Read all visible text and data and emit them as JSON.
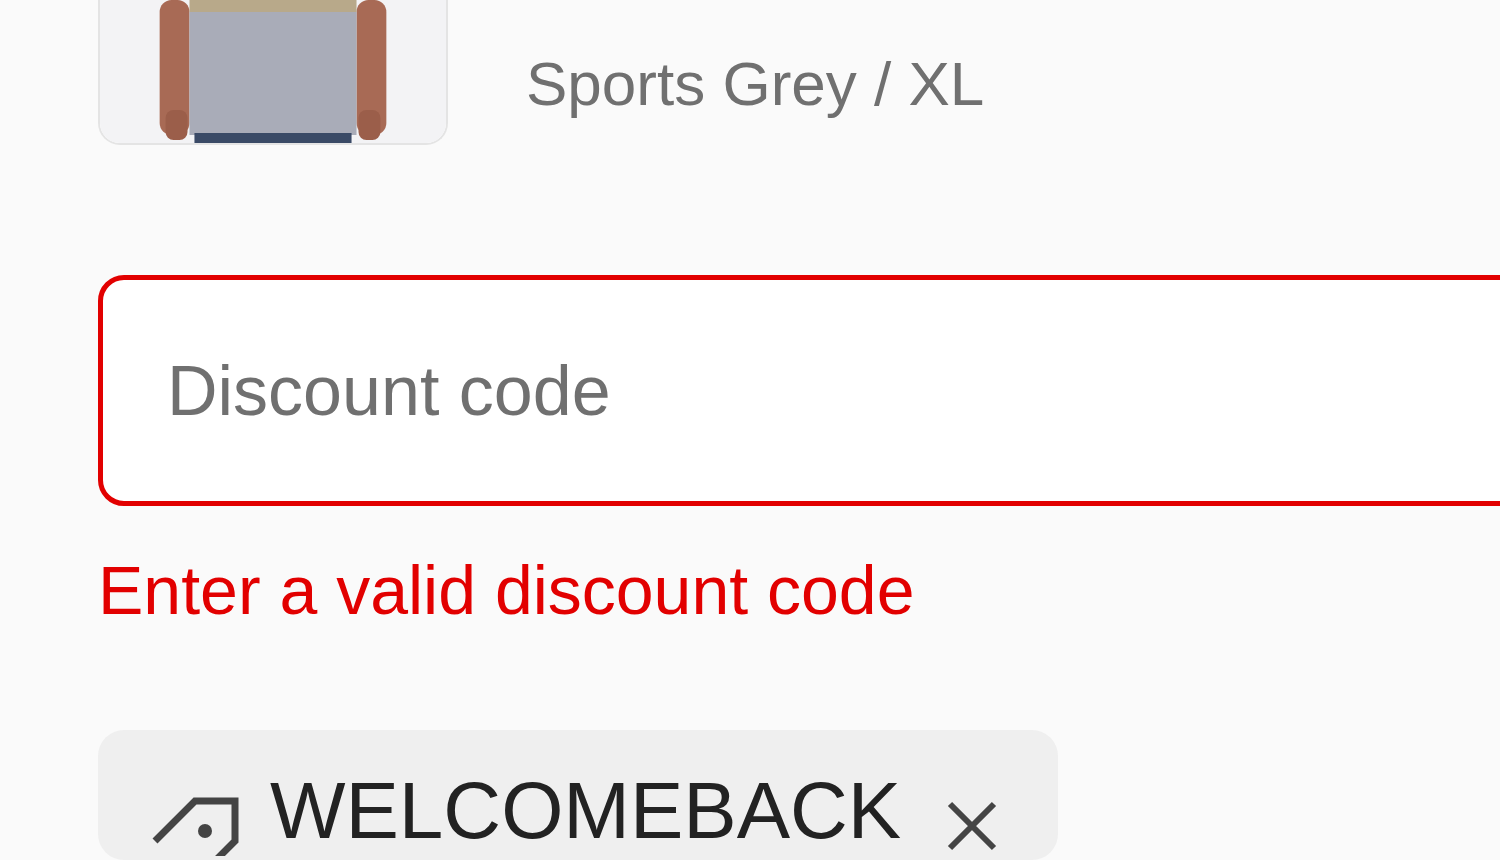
{
  "product": {
    "variant": "Sports Grey / XL"
  },
  "discount": {
    "placeholder": "Discount code",
    "invalid": true,
    "error": "Enter a valid discount code"
  },
  "applied_codes": [
    {
      "code": "WELCOMEBACK"
    }
  ]
}
